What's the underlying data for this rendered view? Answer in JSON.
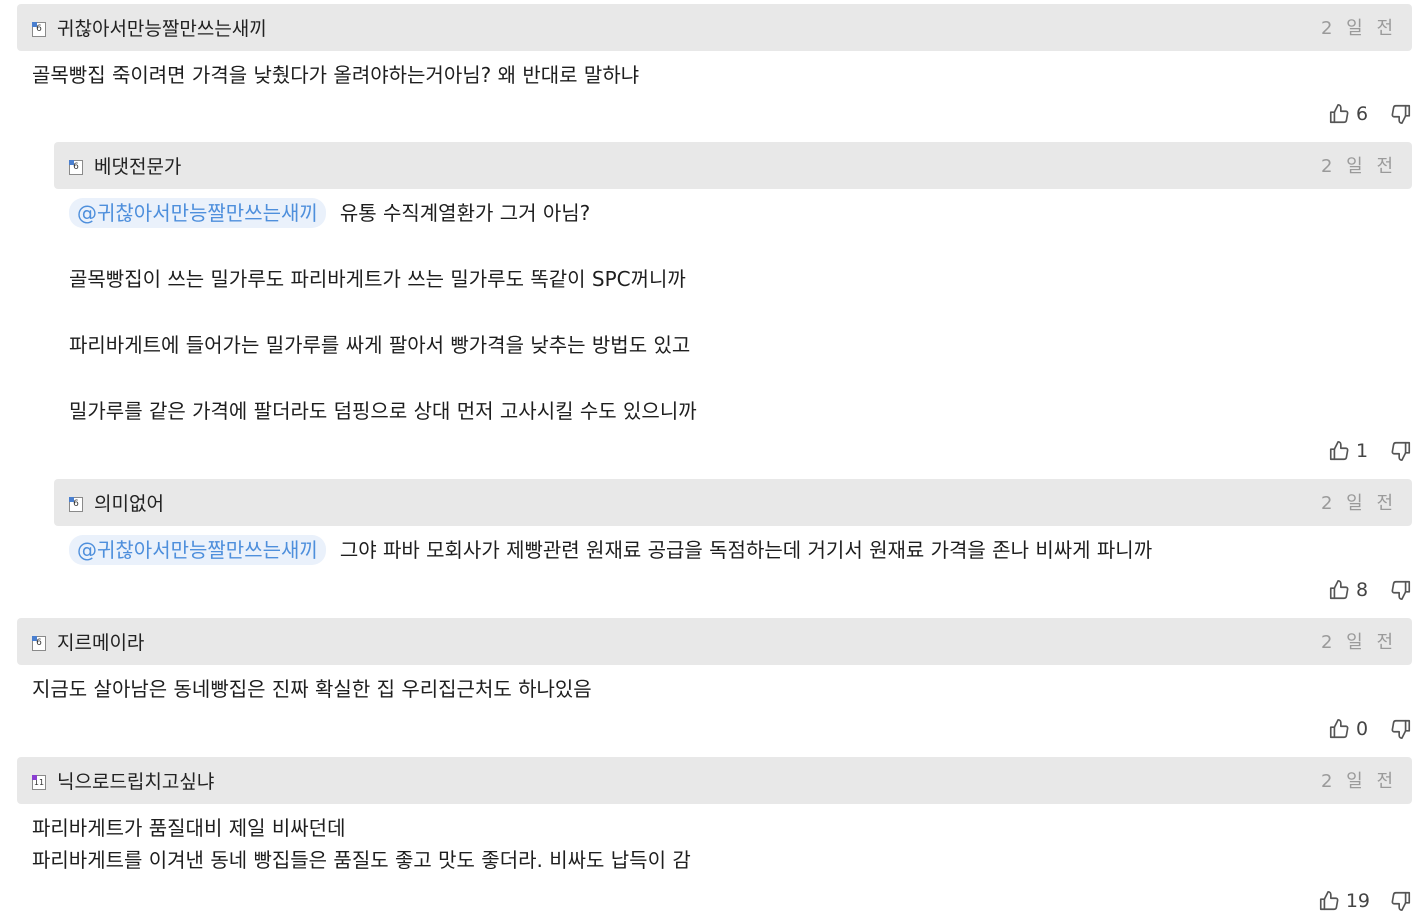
{
  "comments": [
    {
      "author": "귀찮아서만능짤만쓰는새끼",
      "time": "2 일 전",
      "badge_glyph": "6",
      "badge_color": "#4a7fcf",
      "text": "골목빵집 죽이려면 가격을 낮췄다가 올려야하는거아님? 왜 반대로 말하냐",
      "likes": "6"
    },
    {
      "author": "베댓전문가",
      "time": "2 일 전",
      "badge_glyph": "6",
      "badge_color": "#4a7fcf",
      "mention": "@귀찮아서만능짤만쓰는새끼",
      "lines": [
        "유통 수직계열환가 그거 아님?",
        "골목빵집이 쓰는 밀가루도 파리바게트가 쓰는 밀가루도 똑같이 SPC꺼니까",
        "파리바게트에 들어가는 밀가루를 싸게 팔아서 빵가격을 낮추는 방법도 있고",
        "밀가루를 같은 가격에 팔더라도 덤핑으로 상대 먼저 고사시킬 수도 있으니까"
      ],
      "likes": "1"
    },
    {
      "author": "의미없어",
      "time": "2 일 전",
      "badge_glyph": "6",
      "badge_color": "#4a7fcf",
      "mention": "@귀찮아서만능짤만쓰는새끼",
      "text": "그야 파바 모회사가 제빵관련 원재료 공급을 독점하는데 거기서 원재료 가격을 존나 비싸게 파니까",
      "likes": "8"
    },
    {
      "author": "지르메이라",
      "time": "2 일 전",
      "badge_glyph": "6",
      "badge_color": "#4a7fcf",
      "text": "지금도 살아남은 동네빵집은 진짜 확실한 집 우리집근처도 하나있음",
      "likes": "0"
    },
    {
      "author": "닉으로드립치고싶냐",
      "time": "2 일 전",
      "badge_glyph": "11",
      "badge_color": "#8a3fd1",
      "lines": [
        "파리바게트가 품질대비 제일 비싸던데",
        "파리바게트를 이겨낸 동네 빵집들은 품질도 좋고 맛도 좋더라. 비싸도 납득이 감"
      ],
      "likes": "19"
    }
  ],
  "icons": {
    "like": "thumbs-up-icon",
    "dislike": "thumbs-down-icon",
    "level_badge": "level-badge-icon"
  }
}
